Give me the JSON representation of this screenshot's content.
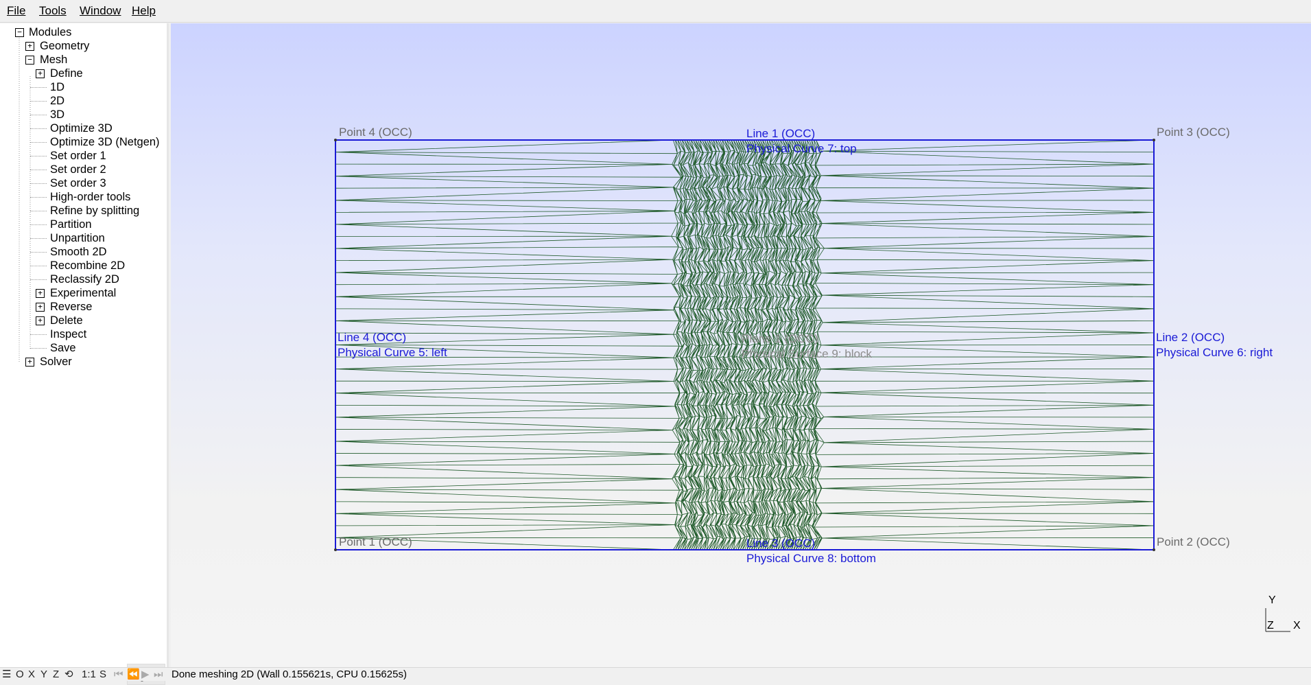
{
  "menu": [
    "File",
    "Tools",
    "Window",
    "Help"
  ],
  "tree": {
    "modules": "Modules",
    "geometry": "Geometry",
    "mesh": "Mesh",
    "define": "Define",
    "mesh_items": [
      "1D",
      "2D",
      "3D",
      "Optimize 3D",
      "Optimize 3D (Netgen)",
      "Set order 1",
      "Set order 2",
      "Set order 3",
      "High-order tools",
      "Refine by splitting",
      "Partition",
      "Unpartition",
      "Smooth 2D",
      "Recombine 2D",
      "Reclassify 2D"
    ],
    "experimental": "Experimental",
    "reverse": "Reverse",
    "delete": "Delete",
    "inspect": "Inspect",
    "save": "Save",
    "solver": "Solver",
    "toggle_collapsed": "+",
    "toggle_expanded": "−"
  },
  "viewport": {
    "point4": "Point 4 (OCC)",
    "point3": "Point 3 (OCC)",
    "point1": "Point 1 (OCC)",
    "point2": "Point 2 (OCC)",
    "line1": "Line 1 (OCC)",
    "line1_phys": "Physical Curve 7: top",
    "line2": "Line 2 (OCC)",
    "line2_phys": "Physical Curve 6: right",
    "line3": "Line 3 (OCC)",
    "line3_phys": "Physical Curve 8: bottom",
    "line4": "Line 4 (OCC)",
    "line4_phys": "Physical Curve 5: left",
    "plane": "Plane 1 (OCC)",
    "plane_phys": "Physical Surface 9: block",
    "axis_y": "Y",
    "axis_z": "Z",
    "axis_x": "X",
    "colors": {
      "boundary": "#1a1ad6",
      "mesh": "#1f5a2a",
      "label_gray": "#6a6a6a"
    }
  },
  "statusbar": {
    "buttons": [
      "☰",
      "O",
      "X",
      "Y",
      "Z",
      "⟲",
      "1:1",
      "S",
      "⏮",
      "⏪",
      "▶",
      "⏭"
    ],
    "message": "Done meshing 2D (Wall 0.155621s, CPU 0.15625s)"
  },
  "icons": {
    "gear": "gear-icon",
    "dropdown": "dropdown-icon"
  }
}
